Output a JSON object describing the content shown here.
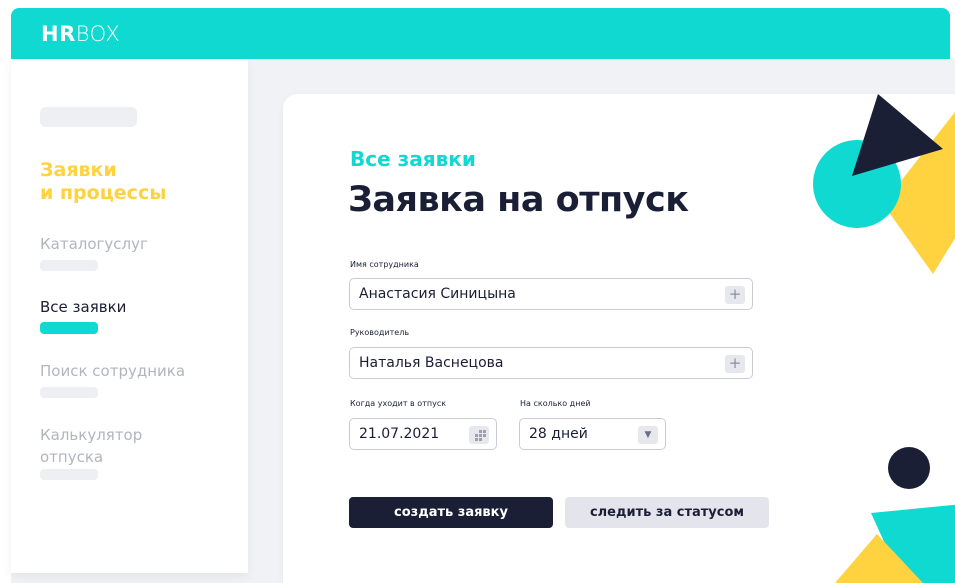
{
  "app": {
    "logo_bold": "HR",
    "logo_light": "BOX"
  },
  "sidebar": {
    "section_title_line1": "Заявки",
    "section_title_line2": "и процессы",
    "items": [
      {
        "label": "Каталогуслуг",
        "active": false
      },
      {
        "label": "Все заявки",
        "active": true
      },
      {
        "label": "Поиск сотрудника",
        "active": false
      },
      {
        "label_line1": "Калькулятор",
        "label_line2": "отпуска",
        "active": false
      }
    ]
  },
  "form": {
    "breadcrumb": "Все заявки",
    "title": "Заявка на отпуск",
    "employee": {
      "label": "Имя сотрудника",
      "value": "Анастасия Синицына"
    },
    "manager": {
      "label": "Руководитель",
      "value": "Наталья Васнецова"
    },
    "start_date": {
      "label": "Когда уходит в отпуск",
      "value": "21.07.2021"
    },
    "days": {
      "label": "На сколько дней",
      "value": "28 дней"
    },
    "create_button": "создать заявку",
    "track_button": "следить за статусом"
  },
  "icons": {
    "plus": "+",
    "dropdown": "▼",
    "calendar": "calendar-icon"
  },
  "colors": {
    "accent": "#0fd9d1",
    "yellow": "#ffd23f",
    "navy": "#1a1f36"
  }
}
